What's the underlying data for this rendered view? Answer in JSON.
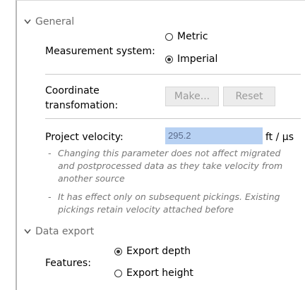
{
  "general": {
    "header": "General",
    "measurement_label": "Measurement system:",
    "measurement_options": [
      "Metric",
      "Imperial"
    ],
    "measurement_selected": "Imperial",
    "coordinate_label_line1": "Coordinate",
    "coordinate_label_line2": "transfomation:",
    "make_button": "Make...",
    "reset_button": "Reset",
    "velocity_label": "Project velocity:",
    "velocity_value": "295.2",
    "velocity_unit": "ft / µs",
    "notes": [
      {
        "lines": [
          "Changing this parameter does not affect migrated",
          "and postprocessed data as they take velocity from",
          "another source"
        ]
      },
      {
        "lines": [
          "It has effect only on subsequent pickings. Existing",
          "pickings retain velocity attached before"
        ]
      }
    ],
    "note_dash": "-"
  },
  "data_export": {
    "header": "Data export",
    "features_label": "Features:",
    "feature_options": [
      "Export depth",
      "Export height"
    ],
    "feature_selected": "Export depth"
  },
  "icons": {
    "chevron": "chevron-down-icon"
  },
  "colors": {
    "input_highlight": "#b7d1f3",
    "header_text": "#6e6e6e",
    "note_text": "#777777"
  }
}
